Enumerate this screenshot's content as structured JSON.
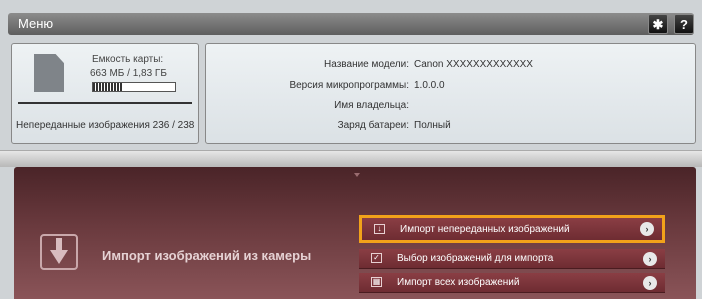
{
  "menu": {
    "title": "Меню",
    "settings_icon": "gear-icon",
    "help_label": "?"
  },
  "card": {
    "icon": "sd-card-icon",
    "capacity_label": "Емкость карты:",
    "capacity_value": "663 МБ / 1,83 ГБ",
    "fill_fraction": 0.36,
    "remaining_label": "Непереданные изображения 236 / 238"
  },
  "camera_info": [
    {
      "key": "Название модели:",
      "value": "Canon XXXXXXXXXXXXX"
    },
    {
      "key": "Версия микропрограммы:",
      "value": "1.0.0.0"
    },
    {
      "key": "Имя владельца:",
      "value": ""
    },
    {
      "key": "Заряд батареи:",
      "value": "Полный"
    }
  ],
  "import_panel": {
    "title": "Импорт изображений из камеры",
    "icon": "camera-import-icon",
    "accent": "#f2a21a",
    "options": [
      {
        "label": "Импорт непереданных изображений",
        "icon": "import-icon",
        "selected": true
      },
      {
        "label": "Выбор изображений для импорта",
        "icon": "checkbox-icon",
        "selected": false
      },
      {
        "label": "Импорт всех изображений",
        "icon": "grid-icon",
        "selected": false
      }
    ]
  }
}
